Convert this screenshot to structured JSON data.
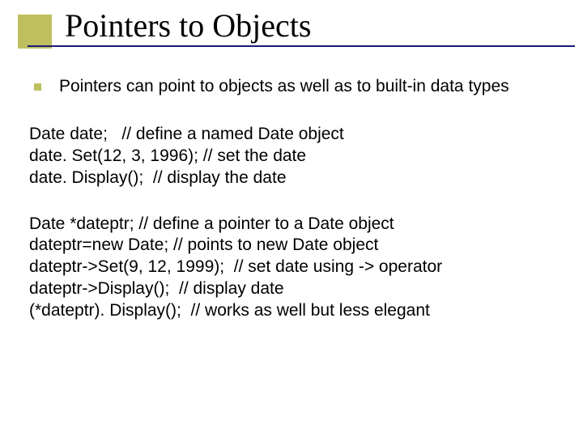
{
  "title": "Pointers to Objects",
  "bullet": "Pointers can point to objects as well as to built-in data types",
  "block1": {
    "l1": "Date date;   // define a named Date object",
    "l2": "date. Set(12, 3, 1996); // set the date",
    "l3": "date. Display();  // display the date"
  },
  "block2": {
    "l1": "Date *dateptr; // define a pointer to a Date object",
    "l2": "dateptr=new Date; // points to new Date object",
    "l3": "dateptr->Set(9, 12, 1999);  // set date using -> operator",
    "l4": "dateptr->Display();  // display date",
    "l5": "(*dateptr). Display();  // works as well but less elegant"
  }
}
